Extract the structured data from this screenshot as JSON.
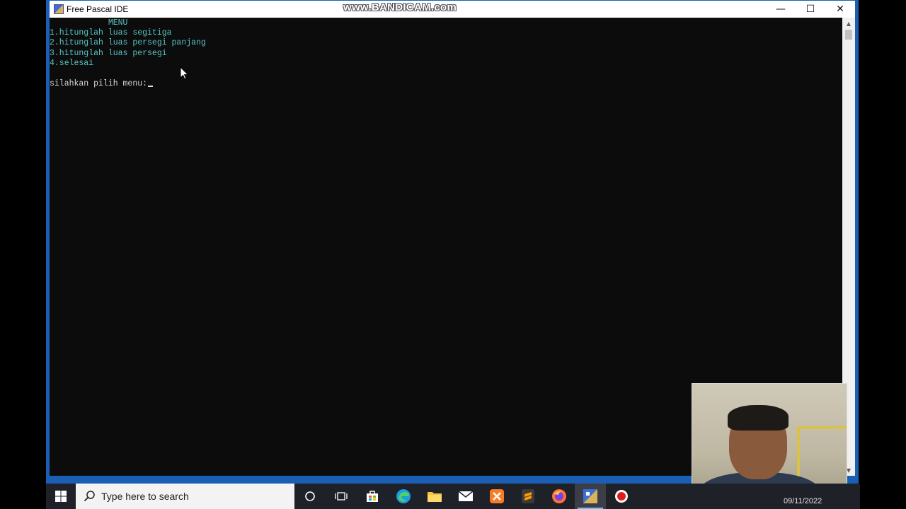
{
  "window": {
    "title": "Free Pascal IDE",
    "watermark": "www.BANDICAM.com",
    "minimize_glyph": "—",
    "maximize_glyph": "☐",
    "close_glyph": "✕"
  },
  "console": {
    "lines": [
      "            MENU",
      "1.hitunglah luas segitiga",
      "2.hitunglah luas persegi panjang",
      "3.hitunglah luas persegi",
      "4.selesai",
      "",
      "silahkan pilih menu:"
    ]
  },
  "taskbar": {
    "search_placeholder": "Type here to search",
    "icons": [
      "windows-start-icon",
      "cortana-icon",
      "task-view-icon",
      "store-icon",
      "edge-icon",
      "file-explorer-icon",
      "mail-icon",
      "xampp-icon",
      "sublime-text-icon",
      "firefox-icon",
      "free-pascal-icon",
      "bandicam-record-icon"
    ],
    "date": "09/11/2022"
  },
  "colors": {
    "console_bg": "#0c0c0c",
    "menu_text": "#58c3c3",
    "prompt_text": "#d8d8d8",
    "window_border": "#1a5fb4",
    "taskbar_bg": "#1f2129"
  }
}
